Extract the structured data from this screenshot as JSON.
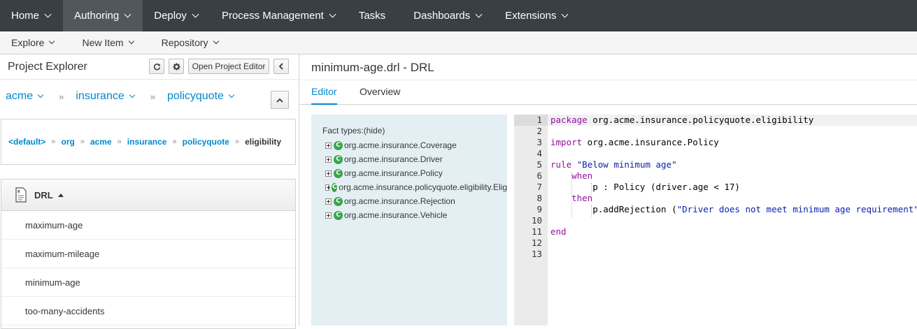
{
  "topnav": {
    "items": [
      {
        "label": "Home"
      },
      {
        "label": "Authoring"
      },
      {
        "label": "Deploy"
      },
      {
        "label": "Process Management"
      },
      {
        "label": "Tasks"
      },
      {
        "label": "Dashboards"
      },
      {
        "label": "Extensions"
      }
    ],
    "active": "Authoring"
  },
  "subnav": {
    "items": [
      {
        "label": "Explore"
      },
      {
        "label": "New Item"
      },
      {
        "label": "Repository"
      }
    ]
  },
  "project_explorer": {
    "title": "Project Explorer",
    "refresh_icon": "refresh-icon",
    "settings_icon": "gear-icon",
    "open_editor_label": "Open Project Editor",
    "collapse_icon": "chevron-left-icon",
    "breadcrumbs": [
      "acme",
      "insurance",
      "policyquote"
    ],
    "package_path": [
      "<default>",
      "org",
      "acme",
      "insurance",
      "policyquote"
    ],
    "package_current": "eligibility",
    "list_header": "DRL",
    "items": [
      "maximum-age",
      "maximum-mileage",
      "minimum-age",
      "too-many-accidents"
    ]
  },
  "editor": {
    "title": "minimum-age.drl - DRL",
    "tabs": [
      "Editor",
      "Overview"
    ],
    "active_tab": "Editor",
    "fact_types_title": "Fact types:(hide)",
    "fact_types": [
      "org.acme.insurance.Coverage",
      "org.acme.insurance.Driver",
      "org.acme.insurance.Policy",
      "org.acme.insurance.policyquote.eligibility.Elig",
      "org.acme.insurance.Rejection",
      "org.acme.insurance.Vehicle"
    ],
    "code_lines": [
      "package org.acme.insurance.policyquote.eligibility",
      "",
      "import org.acme.insurance.Policy",
      "",
      "rule \"Below minimum age\"",
      "    when",
      "        p : Policy (driver.age < 17)",
      "    then",
      "        p.addRejection (\"Driver does not meet minimum age requirement\");",
      "",
      "end",
      "",
      ""
    ],
    "line_numbers": [
      "1",
      "2",
      "3",
      "4",
      "5",
      "6",
      "7",
      "8",
      "9",
      "10",
      "11",
      "12",
      "13"
    ]
  },
  "colors": {
    "topnav_bg": "#393f44",
    "link": "#0088ce",
    "fact_panel": "#e4eff4",
    "keyword": "#93119f"
  }
}
